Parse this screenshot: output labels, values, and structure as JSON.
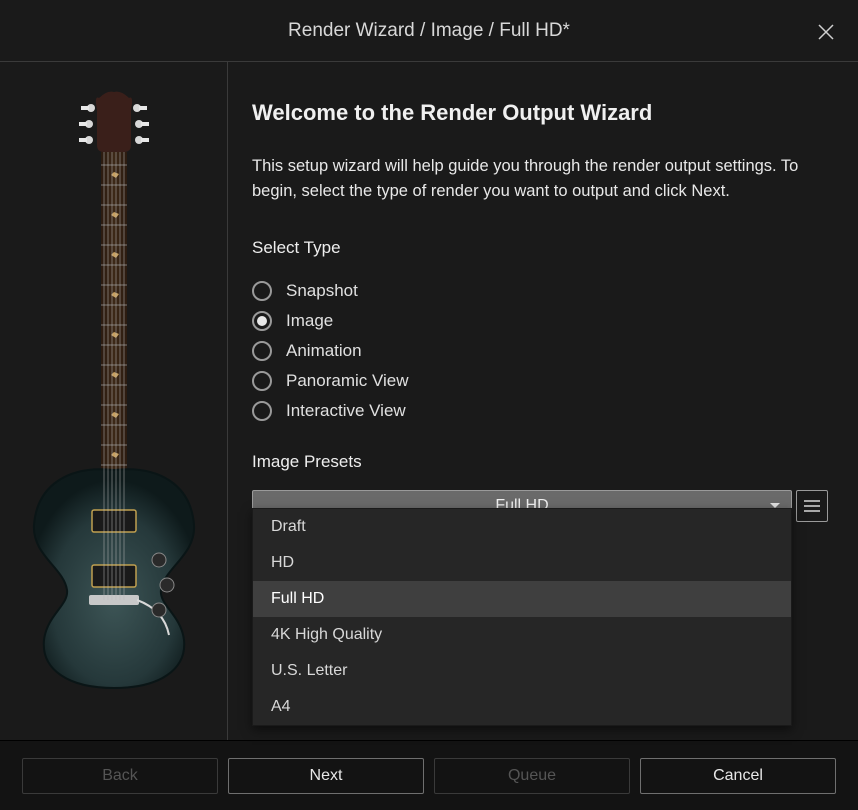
{
  "dialog": {
    "title": "Render Wizard / Image / Full HD*"
  },
  "header": {
    "heading": "Welcome to the Render Output Wizard",
    "intro": "This setup wizard will help guide you through the render output settings. To begin, select the type of render you want to output and click Next."
  },
  "select_type": {
    "label": "Select Type",
    "options": [
      {
        "label": "Snapshot",
        "selected": false
      },
      {
        "label": "Image",
        "selected": true
      },
      {
        "label": "Animation",
        "selected": false
      },
      {
        "label": "Panoramic View",
        "selected": false
      },
      {
        "label": "Interactive View",
        "selected": false
      }
    ]
  },
  "image_presets": {
    "label": "Image Presets",
    "selected": "Full HD",
    "options": [
      {
        "label": "Draft",
        "selected": false
      },
      {
        "label": "HD",
        "selected": false
      },
      {
        "label": "Full HD",
        "selected": true
      },
      {
        "label": "4K High Quality",
        "selected": false
      },
      {
        "label": "U.S. Letter",
        "selected": false
      },
      {
        "label": "A4",
        "selected": false
      }
    ]
  },
  "footer": {
    "back_label": "Back",
    "next_label": "Next",
    "queue_label": "Queue",
    "cancel_label": "Cancel"
  }
}
